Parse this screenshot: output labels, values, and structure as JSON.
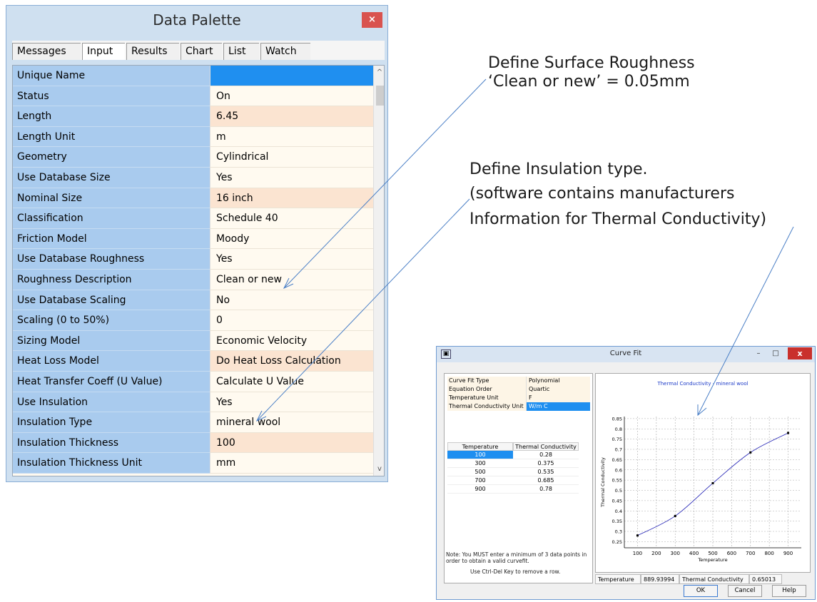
{
  "data_palette": {
    "title": "Data Palette",
    "close_glyph": "×",
    "tabs": [
      "Messages",
      "Input",
      "Results",
      "Chart",
      "List",
      "Watch"
    ],
    "active_tab": "Input",
    "properties": [
      {
        "name": "Unique Name",
        "value": ""
      },
      {
        "name": "Status",
        "value": "On"
      },
      {
        "name": "Length",
        "value": "6.45"
      },
      {
        "name": "Length Unit",
        "value": "m"
      },
      {
        "name": "Geometry",
        "value": "Cylindrical"
      },
      {
        "name": "Use Database Size",
        "value": "Yes"
      },
      {
        "name": "Nominal Size",
        "value": "16 inch"
      },
      {
        "name": "Classification",
        "value": "Schedule 40"
      },
      {
        "name": "Friction Model",
        "value": "Moody"
      },
      {
        "name": "Use Database Roughness",
        "value": "Yes"
      },
      {
        "name": "Roughness Description",
        "value": "Clean or new"
      },
      {
        "name": "Use Database Scaling",
        "value": "No"
      },
      {
        "name": "Scaling (0 to 50%)",
        "value": "0"
      },
      {
        "name": "Sizing Model",
        "value": "Economic Velocity"
      },
      {
        "name": "Heat Loss Model",
        "value": "Do Heat Loss Calculation"
      },
      {
        "name": "Heat Transfer Coeff (U Value)",
        "value": "Calculate U Value"
      },
      {
        "name": "Use Insulation",
        "value": "Yes"
      },
      {
        "name": "Insulation Type",
        "value": "mineral wool"
      },
      {
        "name": "Insulation Thickness",
        "value": "100"
      },
      {
        "name": "Insulation Thickness Unit",
        "value": "mm"
      }
    ],
    "scroll_up": "^",
    "scroll_down": "v"
  },
  "annotations": {
    "roughness_line1": "Define Surface Roughness",
    "roughness_line2": "‘Clean or new’ = 0.05mm",
    "insulation_line1": "Define Insulation type.",
    "insulation_line2": "(software contains  manufacturers",
    "insulation_line3": "Information for Thermal Conductivity)"
  },
  "curve_fit": {
    "title": "Curve Fit",
    "app_icon": "▣",
    "minimize": "–",
    "maximize": "□",
    "close": "x",
    "params": [
      {
        "key": "Curve Fit Type",
        "value": "Polynomial"
      },
      {
        "key": "Equation Order",
        "value": "Quartic"
      },
      {
        "key": "Temperature Unit",
        "value": "F"
      },
      {
        "key": "Thermal Conductivity Unit",
        "value": "W/m C"
      }
    ],
    "table_headers": [
      "Temperature",
      "Thermal Conductivity"
    ],
    "table_rows": [
      [
        "100",
        "0.28"
      ],
      [
        "300",
        "0.375"
      ],
      [
        "500",
        "0.535"
      ],
      [
        "700",
        "0.685"
      ],
      [
        "900",
        "0.78"
      ]
    ],
    "note": "Note: You MUST enter a minimum of 3 data points in order to obtain a valid curvefit.",
    "note2": "Use Ctrl-Del Key to remove a row.",
    "status": {
      "temp_label": "Temperature",
      "temp_value": "889.93994",
      "tc_label": "Thermal Conductivity",
      "tc_value": "0.65013"
    },
    "buttons": {
      "ok": "OK",
      "cancel": "Cancel",
      "help": "Help"
    }
  },
  "chart_data": {
    "type": "line",
    "title": "Thermal Conductivity - mineral wool",
    "xlabel": "Temperature",
    "ylabel": "Thermal Conductivity",
    "x_ticks": [
      100,
      200,
      300,
      400,
      500,
      600,
      700,
      800,
      900
    ],
    "y_ticks": [
      0.25,
      0.3,
      0.35,
      0.4,
      0.45,
      0.5,
      0.55,
      0.6,
      0.65,
      0.7,
      0.75,
      0.8,
      0.85
    ],
    "xlim": [
      30,
      970
    ],
    "ylim": [
      0.22,
      0.86
    ],
    "grid": true,
    "x": [
      100,
      300,
      500,
      700,
      900
    ],
    "y": [
      0.28,
      0.375,
      0.535,
      0.685,
      0.78
    ],
    "title_color": "#1e3cc8",
    "line_color": "#2a2ab8"
  }
}
